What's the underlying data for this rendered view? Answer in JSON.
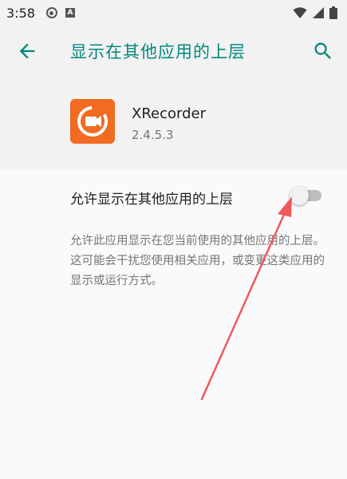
{
  "status_bar": {
    "time": "3:58"
  },
  "app_bar": {
    "title": "显示在其他应用的上层"
  },
  "app": {
    "name": "XRecorder",
    "version": "2.4.5.3",
    "icon_color": "#f16b22"
  },
  "setting": {
    "label": "允许显示在其他应用的上层",
    "enabled": false
  },
  "description": "允许此应用显示在您当前使用的其他应用的上层。这可能会干扰您使用相关应用，或变更这类应用的显示或运行方式。",
  "colors": {
    "accent": "#00897b",
    "annotation_arrow": "#f0595a"
  }
}
